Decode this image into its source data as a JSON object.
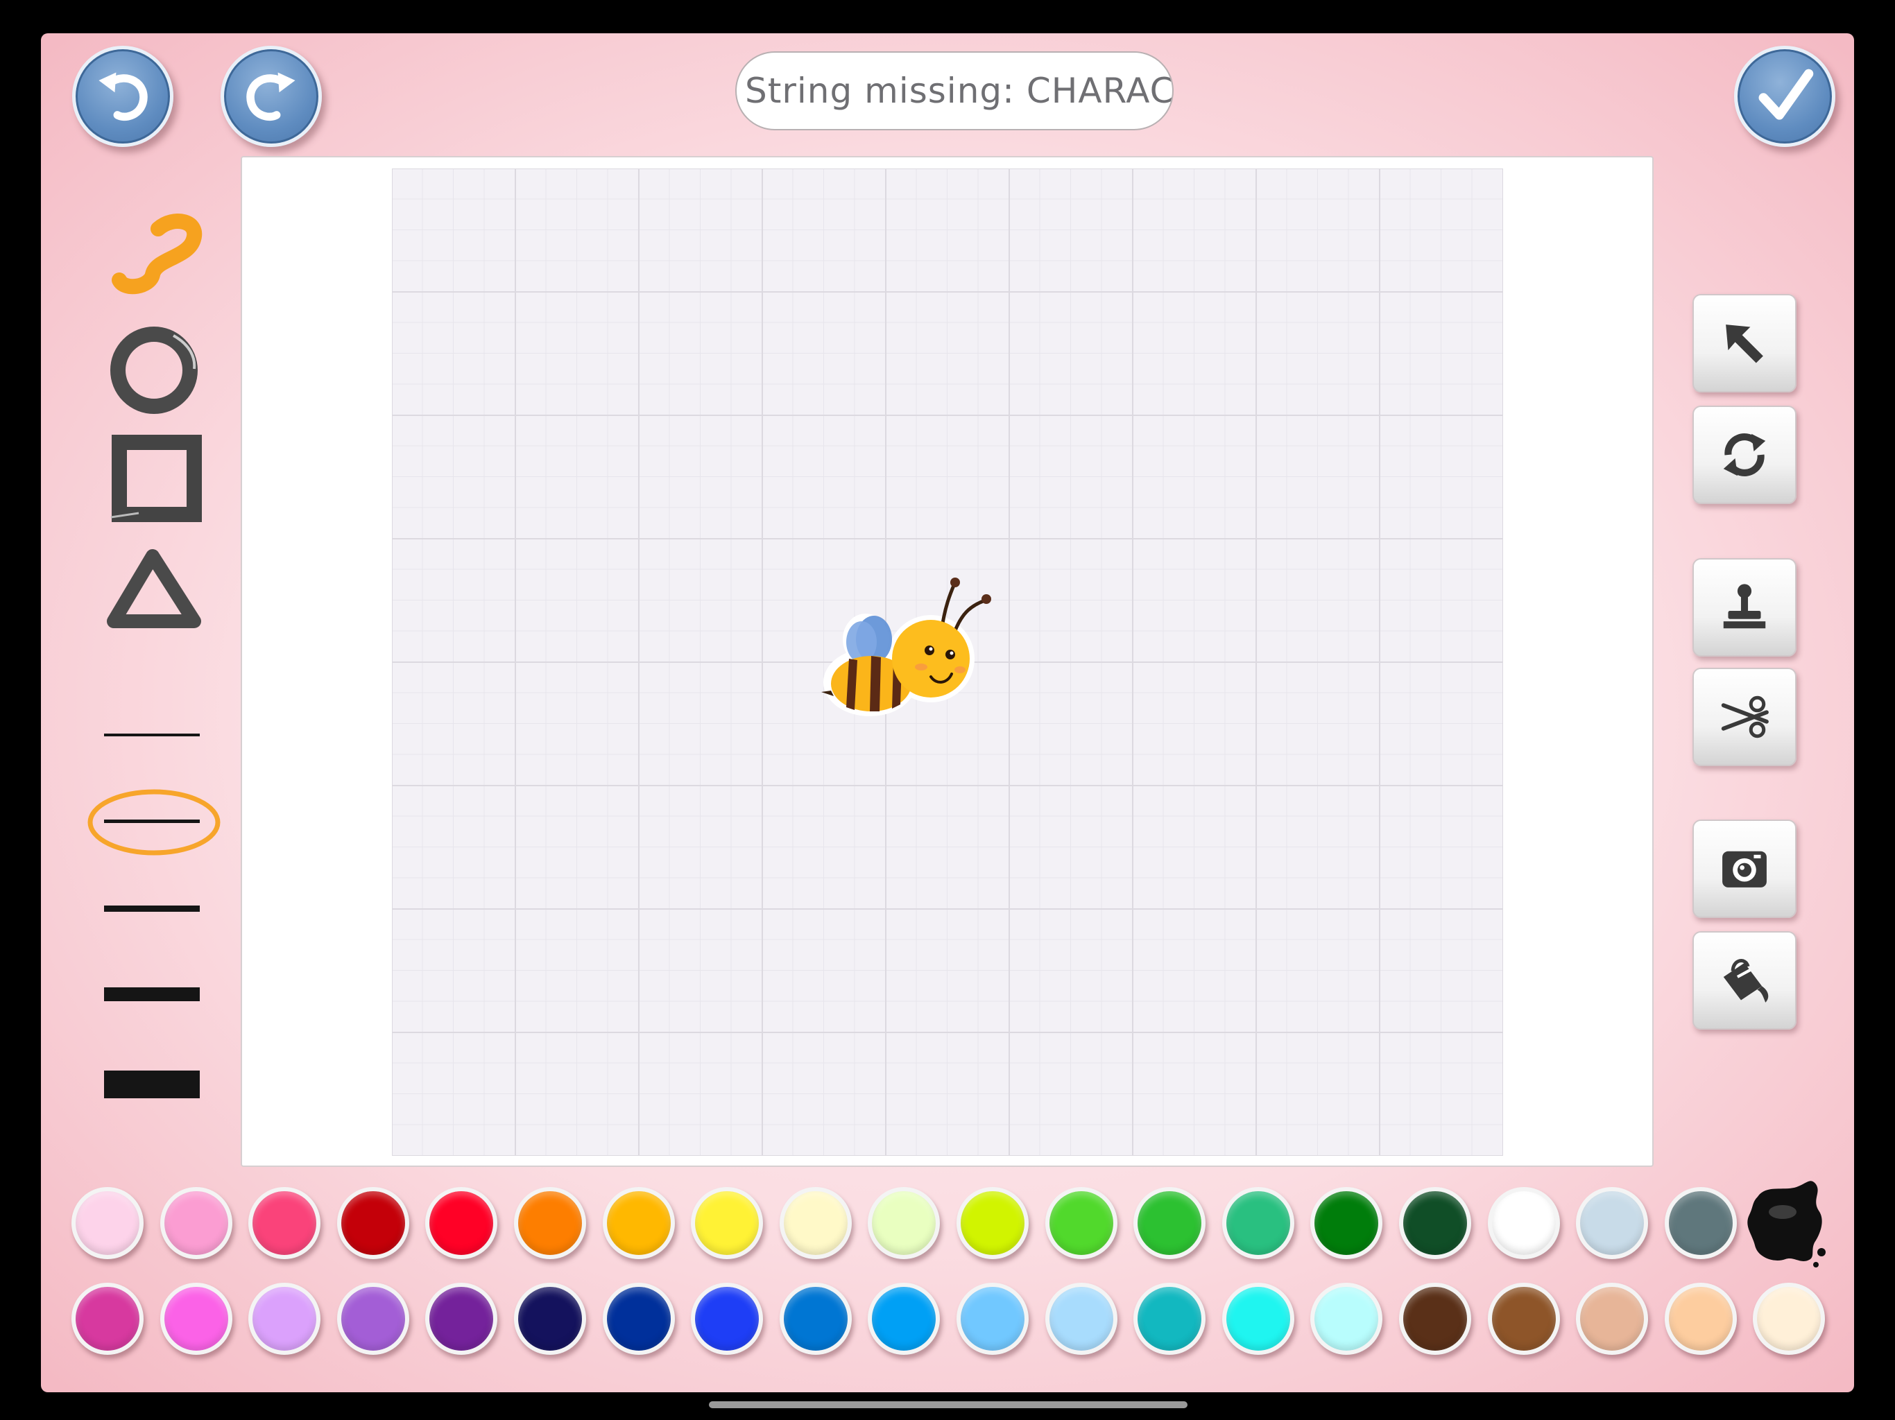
{
  "header": {
    "title": "String missing: CHARACTER_STR_NAME_CHANGE",
    "undo_icon": "undo-icon",
    "redo_icon": "redo-icon",
    "done_icon": "checkmark-icon"
  },
  "left_tools": [
    {
      "name": "freehand-brush-tool",
      "icon": "squiggle-icon",
      "selected": true
    },
    {
      "name": "circle-tool",
      "icon": "circle-icon"
    },
    {
      "name": "rectangle-tool",
      "icon": "square-icon"
    },
    {
      "name": "triangle-tool",
      "icon": "triangle-icon"
    }
  ],
  "line_widths": {
    "options": [
      "extra-thin",
      "thin",
      "medium",
      "thick",
      "extra-thick"
    ],
    "selected": "thin"
  },
  "right_tools": [
    {
      "name": "select-tool",
      "icon": "arrow-pointer-icon"
    },
    {
      "name": "rotate-tool",
      "icon": "rotate-icon"
    },
    {
      "name": "stamp-tool",
      "icon": "stamp-icon"
    },
    {
      "name": "scissors-tool",
      "icon": "scissors-icon"
    },
    {
      "name": "camera-tool",
      "icon": "camera-icon"
    },
    {
      "name": "fill-bucket-tool",
      "icon": "paint-bucket-icon"
    }
  ],
  "canvas": {
    "sticker": "bee-sticker"
  },
  "palette": {
    "row1": [
      "#fdd3ea",
      "#fb9dd2",
      "#fa437a",
      "#c40009",
      "#ff0126",
      "#fd7e00",
      "#ffb800",
      "#fff235",
      "#fff9c8",
      "#e9ffc0",
      "#d1f400",
      "#51d92c",
      "#2cc131",
      "#29c080",
      "#007d0b",
      "#104e27",
      "#ffffff",
      "#c8dbe8",
      "#5f777c"
    ],
    "row2": [
      "#d7399f",
      "#fb62e7",
      "#dba1fc",
      "#a35ed6",
      "#74229b",
      "#14125d",
      "#00309b",
      "#1e3ef6",
      "#0076d3",
      "#00a0f5",
      "#71c8ff",
      "#a8dcfd",
      "#12b8c0",
      "#1ff5f0",
      "#b8fdfd",
      "#5a3018",
      "#8e5529",
      "#e7b598",
      "#fdcd9f",
      "#fff0d8"
    ],
    "special": "ink-splat-icon"
  }
}
